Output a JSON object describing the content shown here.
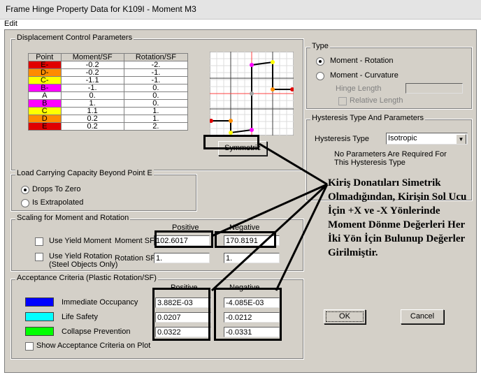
{
  "window": {
    "title": "Frame Hinge Property Data for K109I - Moment M3"
  },
  "menu": {
    "edit": "Edit"
  },
  "displacement": {
    "title": "Displacement Control Parameters",
    "headers": [
      "Point",
      "Moment/SF",
      "Rotation/SF"
    ],
    "rows": [
      {
        "point": "E-",
        "moment": "-0.2",
        "rotation": "-2.",
        "color": "#e00000"
      },
      {
        "point": "D-",
        "moment": "-0.2",
        "rotation": "-1.",
        "color": "#ff8c00"
      },
      {
        "point": "C-",
        "moment": "-1.1",
        "rotation": "-1.",
        "color": "#ffff00"
      },
      {
        "point": "B-",
        "moment": "-1.",
        "rotation": "0.",
        "color": "#ff00ff"
      },
      {
        "point": "A",
        "moment": "0.",
        "rotation": "0.",
        "color": "#ffffff"
      },
      {
        "point": "B",
        "moment": "1.",
        "rotation": "0.",
        "color": "#ff00ff"
      },
      {
        "point": "C",
        "moment": "1.1",
        "rotation": "1.",
        "color": "#ffff00"
      },
      {
        "point": "D",
        "moment": "0.2",
        "rotation": "1.",
        "color": "#ff8c00"
      },
      {
        "point": "E",
        "moment": "0.2",
        "rotation": "2.",
        "color": "#e00000"
      }
    ],
    "symmetric_label": "Symmetric"
  },
  "type": {
    "title": "Type",
    "moment_rotation": "Moment - Rotation",
    "moment_curvature": "Moment - Curvature",
    "hinge_length": "Hinge Length",
    "relative_length": "Relative Length",
    "selected": "moment_rotation"
  },
  "hysteresis": {
    "title": "Hysteresis Type And Parameters",
    "label": "Hysteresis Type",
    "value": "Isotropic",
    "note": "No Parameters Are Required For This Hysteresis Type"
  },
  "load_capacity": {
    "title": "Load Carrying Capacity Beyond Point E",
    "drops": "Drops To Zero",
    "extrapolated": "Is Extrapolated",
    "selected": "drops"
  },
  "scaling": {
    "title": "Scaling for Moment and Rotation",
    "positive": "Positive",
    "negative": "Negative",
    "use_yield_moment": "Use Yield Moment",
    "moment_sf": "Moment SF",
    "moment_pos": "102.6017",
    "moment_neg": "170.8191",
    "use_yield_rotation": "Use Yield Rotation",
    "steel_only": "(Steel Objects Only)",
    "rotation_sf": "Rotation SF",
    "rotation_pos": "1.",
    "rotation_neg": "1."
  },
  "acceptance": {
    "title": "Acceptance Criteria (Plastic Rotation/SF)",
    "positive": "Positive",
    "negative": "Negative",
    "rows": [
      {
        "label": "Immediate Occupancy",
        "color": "#0000ff",
        "pos": "3.882E-03",
        "neg": "-4.085E-03"
      },
      {
        "label": "Life Safety",
        "color": "#00ffff",
        "pos": "0.0207",
        "neg": "-0.0212"
      },
      {
        "label": "Collapse Prevention",
        "color": "#00ff00",
        "pos": "0.0322",
        "neg": "-0.0331"
      }
    ],
    "show_on_plot": "Show Acceptance Criteria on Plot"
  },
  "buttons": {
    "ok": "OK",
    "cancel": "Cancel"
  },
  "annotation": "Kiriş Donatıları Simetrik Olmadığından, Kirişin Sol Ucu İçin +X ve -X Yönlerinde Moment Dönme Değerleri Her İki Yön İçin Bulunup Değerler Girilmiştir."
}
